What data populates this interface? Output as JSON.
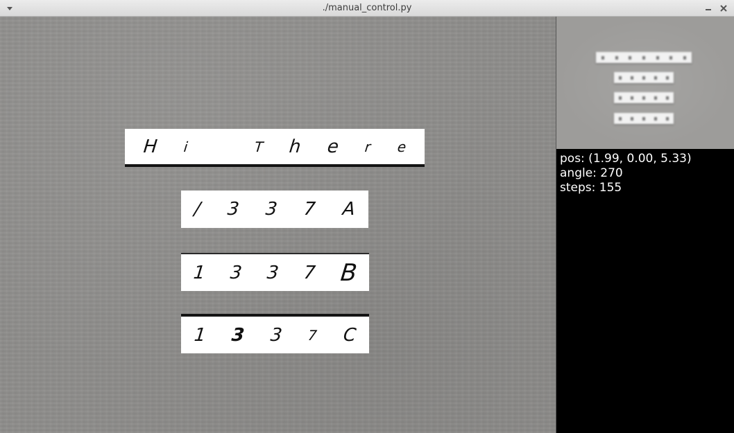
{
  "window": {
    "title": "./manual_control.py",
    "menu_icon": "chevron-down-icon",
    "minimize_icon": "minimize-icon",
    "close_icon": "close-icon"
  },
  "scene": {
    "boards": [
      {
        "name": "board-hi-there",
        "glyphs": [
          "H",
          "i",
          "",
          "T",
          "h",
          "e",
          "r",
          "e"
        ]
      },
      {
        "name": "board-1337a",
        "glyphs": [
          "/",
          "3",
          "3",
          "7",
          "A"
        ]
      },
      {
        "name": "board-1337b",
        "glyphs": [
          "1",
          "3",
          "3",
          "7",
          "B"
        ]
      },
      {
        "name": "board-1337c",
        "glyphs": [
          "1",
          "3",
          "3",
          "7",
          "C"
        ]
      }
    ]
  },
  "stats": {
    "pos": "pos: (1.99, 0.00, 5.33)",
    "angle": "angle: 270",
    "steps": "steps: 155"
  },
  "colors": {
    "floor": "#8e8d8b",
    "board": "#ffffff",
    "panel": "#000000",
    "text": "#ffffff"
  }
}
